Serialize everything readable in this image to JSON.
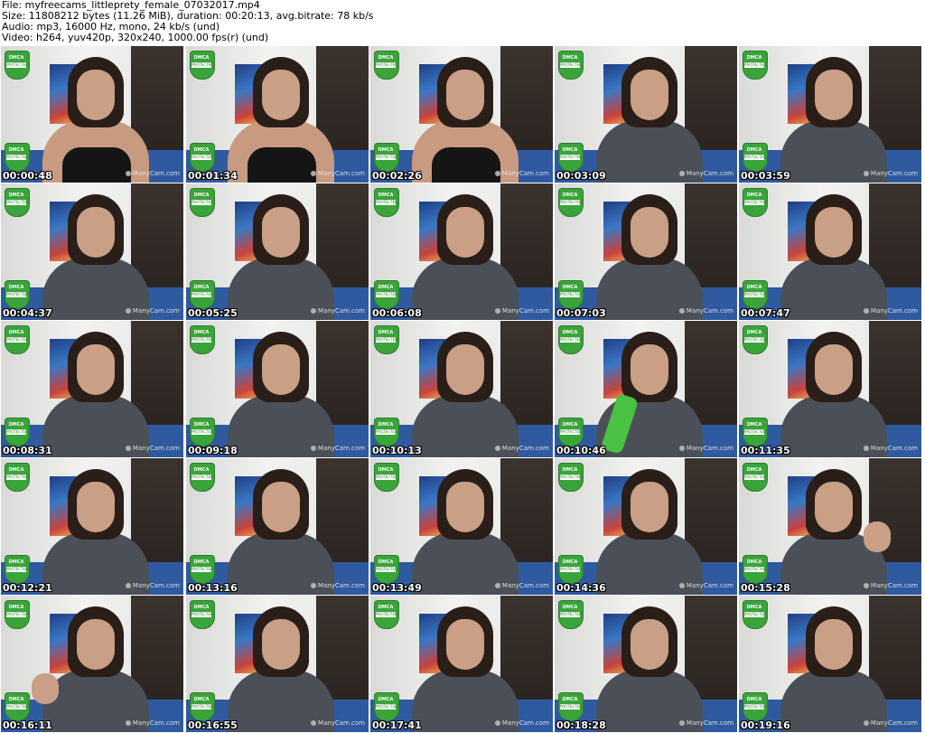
{
  "header": {
    "file_line": "File: myfreecams_littleprety_female_07032017.mp4",
    "size_line": "Size: 11808212 bytes (11.26 MiB), duration: 00:20:13, avg.bitrate: 78 kb/s",
    "audio_line": "Audio: mp3, 16000 Hz, mono, 24 kb/s (und)",
    "video_line": "Video: h264, yuv420p, 320x240, 1000.00 fps(r) (und)"
  },
  "badge": {
    "top_text": "DMCA",
    "band_text": "PROTECTED"
  },
  "watermark": "ManyCam.com",
  "thumbnails": [
    {
      "timestamp": "00:00:48",
      "outfit": "tank"
    },
    {
      "timestamp": "00:01:34",
      "outfit": "tank"
    },
    {
      "timestamp": "00:02:26",
      "outfit": "tank"
    },
    {
      "timestamp": "00:03:09",
      "outfit": "hoodie"
    },
    {
      "timestamp": "00:03:59",
      "outfit": "hoodie"
    },
    {
      "timestamp": "00:04:37",
      "outfit": "hoodie"
    },
    {
      "timestamp": "00:05:25",
      "outfit": "hoodie"
    },
    {
      "timestamp": "00:06:08",
      "outfit": "hoodie"
    },
    {
      "timestamp": "00:07:03",
      "outfit": "hoodie"
    },
    {
      "timestamp": "00:07:47",
      "outfit": "hoodie"
    },
    {
      "timestamp": "00:08:31",
      "outfit": "hoodie"
    },
    {
      "timestamp": "00:09:18",
      "outfit": "hoodie"
    },
    {
      "timestamp": "00:10:13",
      "outfit": "hoodie"
    },
    {
      "timestamp": "00:10:46",
      "outfit": "hoodie",
      "prop": "bottle"
    },
    {
      "timestamp": "00:11:35",
      "outfit": "hoodie"
    },
    {
      "timestamp": "00:12:21",
      "outfit": "hoodie"
    },
    {
      "timestamp": "00:13:16",
      "outfit": "hoodie"
    },
    {
      "timestamp": "00:13:49",
      "outfit": "hoodie"
    },
    {
      "timestamp": "00:14:36",
      "outfit": "hoodie"
    },
    {
      "timestamp": "00:15:28",
      "outfit": "hoodie",
      "prop": "hand"
    },
    {
      "timestamp": "00:16:11",
      "outfit": "hoodie",
      "prop": "hand"
    },
    {
      "timestamp": "00:16:55",
      "outfit": "hoodie"
    },
    {
      "timestamp": "00:17:41",
      "outfit": "hoodie"
    },
    {
      "timestamp": "00:18:28",
      "outfit": "hoodie"
    },
    {
      "timestamp": "00:19:16",
      "outfit": "hoodie"
    }
  ],
  "colors": {
    "badge_green": "#3aa43a",
    "sofa_blue": "#2f5aa0",
    "hoodie_gray": "#4b4f57",
    "bottle_green": "#49c142"
  }
}
